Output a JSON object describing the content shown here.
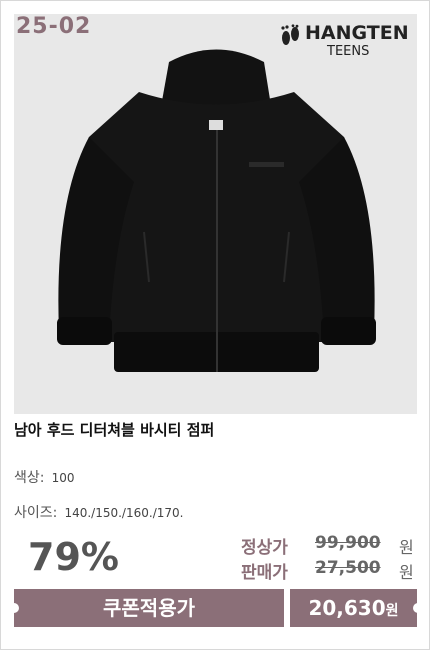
{
  "badge": {
    "season": "25-02"
  },
  "brand": {
    "name": "HANGTEN",
    "sub": "TEENS",
    "icon": "footprints-icon"
  },
  "product": {
    "title": "남아 후드 디터쳐블 바시티 점퍼",
    "color_label": "색상",
    "color_value": "100",
    "size_label": "사이즈",
    "size_value": "140./150./160./170."
  },
  "pricing": {
    "discount": "79%",
    "regular_label": "정상가",
    "regular_price": "99,900",
    "sale_label": "판매가",
    "sale_price": "27,500",
    "currency": "원",
    "coupon_label": "쿠폰적용가",
    "coupon_price": "20,630",
    "accent_color": "#8b6f78"
  }
}
